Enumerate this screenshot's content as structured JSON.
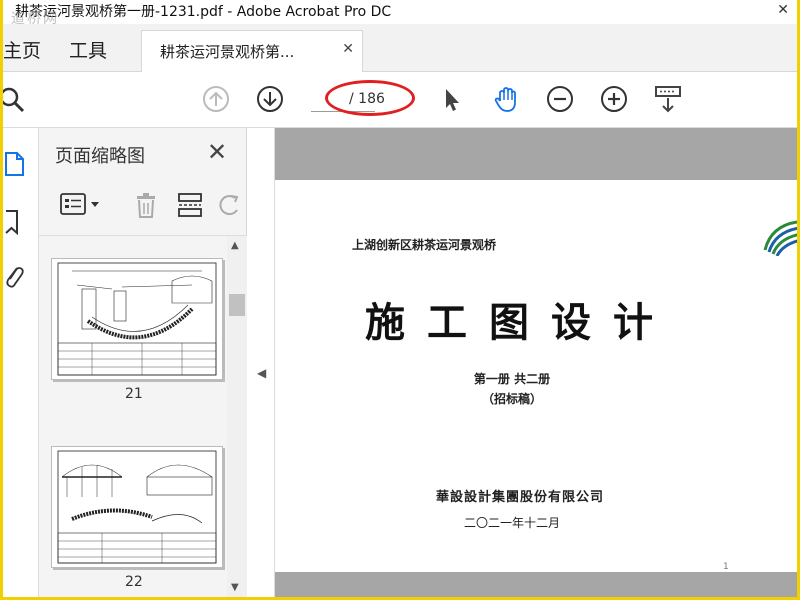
{
  "window": {
    "title": "耕茶运河景观桥第一册-1231.pdf - Adobe Acrobat Pro DC",
    "watermark": "道桥网",
    "close": "✕"
  },
  "tabs": {
    "home": "主页",
    "tools": "工具",
    "document": "耕茶运河景观桥第...",
    "document_close": "✕"
  },
  "toolbar": {
    "page_current": "",
    "page_total": "/ 186",
    "icons": [
      "search-icon",
      "page-up-icon",
      "page-down-icon",
      "select-cursor-icon",
      "hand-tool-icon",
      "zoom-out-icon",
      "zoom-in-icon",
      "scroll-mode-icon"
    ]
  },
  "thumbnails": {
    "title": "页面缩略图",
    "close": "✕",
    "pages": [
      "21",
      "22"
    ]
  },
  "document": {
    "project": "上湖创新区耕茶运河景观桥",
    "main_title": "施工图设计",
    "volume": "第一册  共二册",
    "draft": "（招标稿）",
    "company": "華設設計集團股份有限公司",
    "date": "二〇二一年十二月",
    "page_index": "1"
  },
  "colors": {
    "accent_blue": "#1473e6",
    "annotation_red": "#e02020",
    "frame_yellow": "#f0d000"
  }
}
